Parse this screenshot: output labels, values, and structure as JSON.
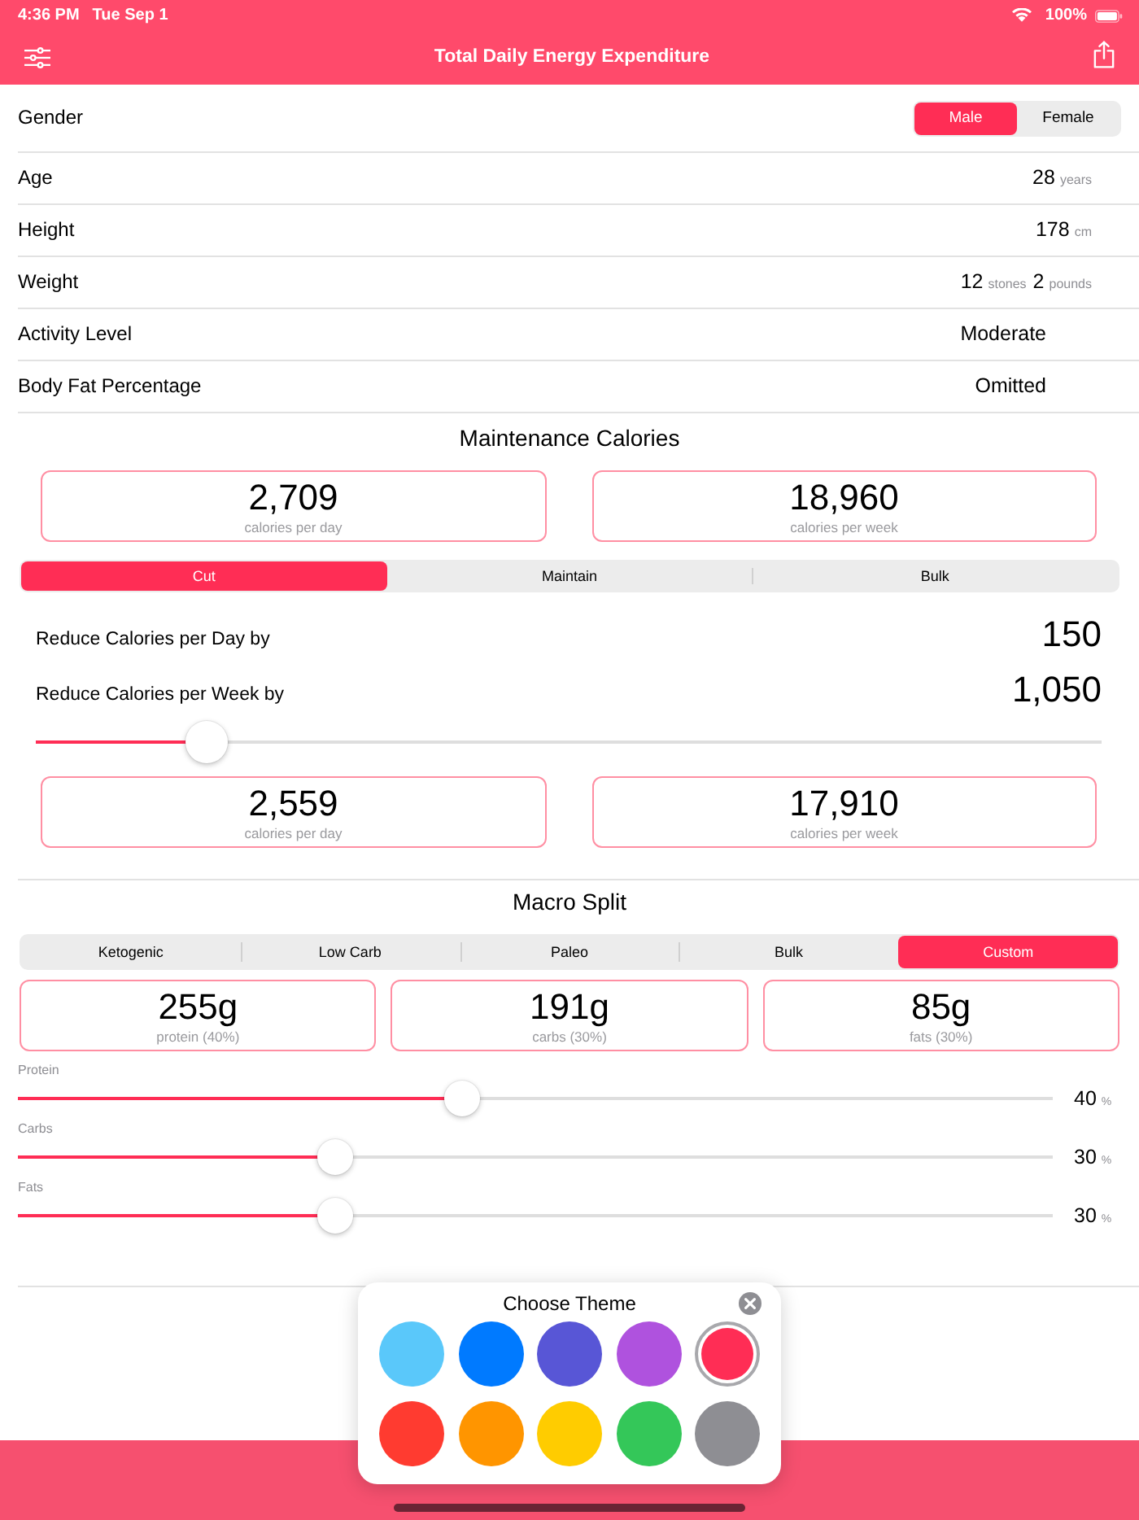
{
  "status_bar": {
    "time": "4:36 PM",
    "date": "Tue Sep 1",
    "battery": "100%"
  },
  "nav_bar": {
    "title": "Total Daily Energy Expenditure"
  },
  "gender": {
    "label": "Gender",
    "options": [
      {
        "label": "Male",
        "selected": true
      },
      {
        "label": "Female",
        "selected": false
      }
    ]
  },
  "rows": [
    {
      "label": "Age",
      "kind": "measure",
      "parts": [
        {
          "value": "28",
          "unit": "years"
        }
      ]
    },
    {
      "label": "Height",
      "kind": "measure",
      "parts": [
        {
          "value": "178",
          "unit": "cm"
        }
      ]
    },
    {
      "label": "Weight",
      "kind": "measure",
      "parts": [
        {
          "value": "12",
          "unit": "stones"
        },
        {
          "value": "2",
          "unit": "pounds"
        }
      ]
    },
    {
      "label": "Activity Level",
      "kind": "choice",
      "value": "Moderate"
    },
    {
      "label": "Body Fat Percentage",
      "kind": "choice",
      "value": "Omitted"
    }
  ],
  "maintenance": {
    "title": "Maintenance Calories",
    "cards": [
      {
        "value": "2,709",
        "caption": "calories per day"
      },
      {
        "value": "18,960",
        "caption": "calories per week"
      }
    ],
    "goal_tabs": [
      {
        "label": "Cut",
        "selected": true
      },
      {
        "label": "Maintain",
        "selected": false
      },
      {
        "label": "Bulk",
        "selected": false
      }
    ],
    "adjustments": [
      {
        "label": "Reduce Calories per Day by",
        "value": "150"
      },
      {
        "label": "Reduce Calories per Week by",
        "value": "1,050"
      }
    ],
    "slider": {
      "level": 0.16
    },
    "result_cards": [
      {
        "value": "2,559",
        "caption": "calories per day"
      },
      {
        "value": "17,910",
        "caption": "calories per week"
      }
    ]
  },
  "macro_split": {
    "title": "Macro Split",
    "tabs": [
      {
        "label": "Ketogenic",
        "selected": false
      },
      {
        "label": "Low Carb",
        "selected": false
      },
      {
        "label": "Paleo",
        "selected": false
      },
      {
        "label": "Bulk",
        "selected": false
      },
      {
        "label": "Custom",
        "selected": true
      }
    ],
    "cards": [
      {
        "value": "255g",
        "caption": "protein (40%)"
      },
      {
        "value": "191g",
        "caption": "carbs (30%)"
      },
      {
        "value": "85g",
        "caption": "fats (30%)"
      }
    ],
    "sliders": [
      {
        "label": "Protein",
        "level": 0.43,
        "value": "40",
        "unit": "%"
      },
      {
        "label": "Carbs",
        "level": 0.306,
        "value": "30",
        "unit": "%"
      },
      {
        "label": "Fats",
        "level": 0.306,
        "value": "30",
        "unit": "%"
      }
    ]
  },
  "theme_picker": {
    "title": "Choose Theme",
    "swatches": [
      {
        "color": "#5ac8fa",
        "selected": false
      },
      {
        "color": "#007aff",
        "selected": false
      },
      {
        "color": "#5856d6",
        "selected": false
      },
      {
        "color": "#af52de",
        "selected": false
      },
      {
        "color": "#ff2d55",
        "selected": true
      },
      {
        "color": "#ff3b30",
        "selected": false
      },
      {
        "color": "#ff9500",
        "selected": false
      },
      {
        "color": "#ffcc00",
        "selected": false
      },
      {
        "color": "#34c759",
        "selected": false
      },
      {
        "color": "#8e8e93",
        "selected": false
      }
    ]
  }
}
